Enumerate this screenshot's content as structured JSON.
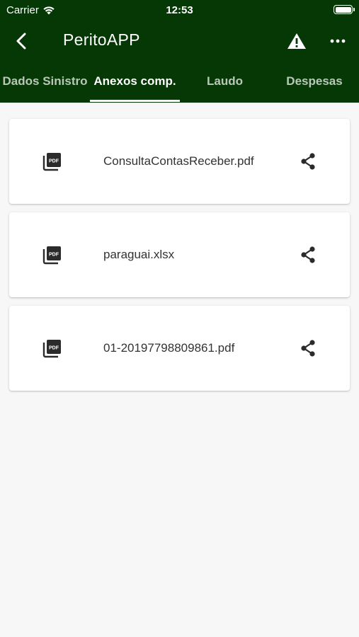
{
  "status_bar": {
    "carrier": "Carrier",
    "time": "12:53"
  },
  "app_bar": {
    "title": "PeritoAPP",
    "icons": [
      "back-arrow-icon",
      "warning-icon",
      "more-horizontal-icon"
    ]
  },
  "tabs": [
    {
      "label": "Dados Sinistro",
      "active": false
    },
    {
      "label": "Anexos comp.",
      "active": true
    },
    {
      "label": "Laudo",
      "active": false
    },
    {
      "label": "Despesas",
      "active": false
    }
  ],
  "attachments": [
    {
      "file_name": "ConsultaContasReceber.pdf",
      "icon": "pdf-file-icon"
    },
    {
      "file_name": "paraguai.xlsx",
      "icon": "pdf-file-icon"
    },
    {
      "file_name": "01-20197798809861.pdf",
      "icon": "pdf-file-icon"
    }
  ],
  "colors": {
    "primary": "#053804",
    "background": "#f7f7f7",
    "card": "#ffffff",
    "text": "#333333"
  }
}
